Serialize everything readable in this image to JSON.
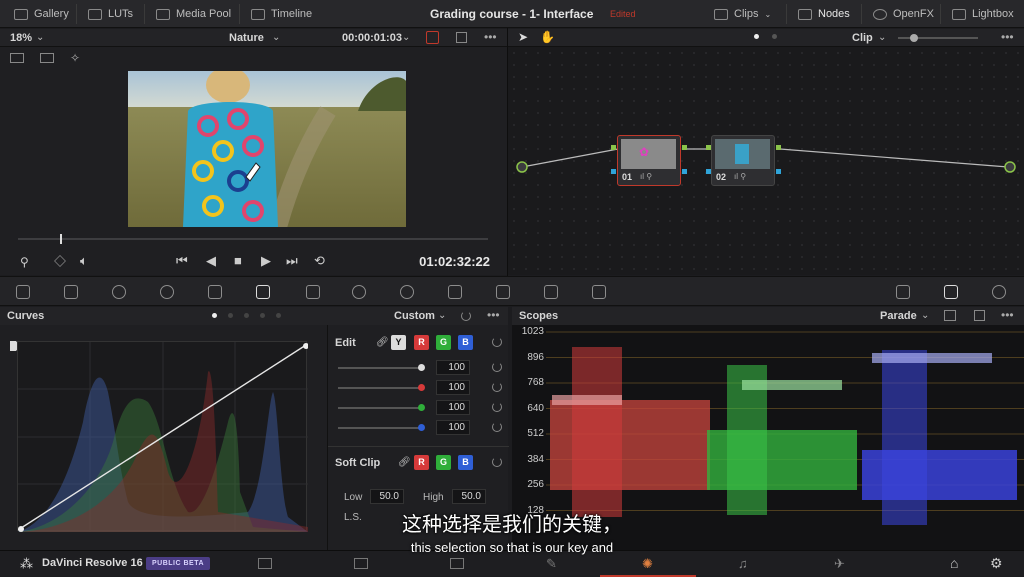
{
  "topbar": {
    "gallery": "Gallery",
    "luts": "LUTs",
    "media_pool": "Media Pool",
    "timeline": "Timeline",
    "project_title": "Grading course - 1- Interface",
    "edited": "Edited",
    "clips": "Clips",
    "nodes": "Nodes",
    "openfx": "OpenFX",
    "lightbox": "Lightbox"
  },
  "viewer": {
    "zoom": "18%",
    "clip_name": "Nature",
    "source_tc": "00:00:01:03",
    "record_tc": "01:02:32:22"
  },
  "node_editor": {
    "mode": "Clip",
    "node1_label": "01",
    "node2_label": "02"
  },
  "curves": {
    "title": "Curves",
    "preset": "Custom",
    "edit_label": "Edit",
    "channels": [
      "Y",
      "R",
      "G",
      "B"
    ],
    "values": [
      "100",
      "100",
      "100",
      "100"
    ],
    "soft_clip_label": "Soft Clip",
    "low_label": "Low",
    "low_value": "50.0",
    "high_label": "High",
    "high_value": "50.0",
    "ls_label": "L.S."
  },
  "scopes": {
    "title": "Scopes",
    "mode": "Parade",
    "ticks": [
      "1023",
      "896",
      "768",
      "640",
      "512",
      "384",
      "256",
      "128"
    ]
  },
  "footer": {
    "app_name": "DaVinci Resolve 16",
    "badge": "PUBLIC BETA"
  },
  "subtitle": {
    "zh": "这种选择是我们的关键，",
    "en": "this selection so that is our key and"
  },
  "colors": {
    "accent_red": "#c0392b",
    "channel_r": "#d63a3a",
    "channel_g": "#2fae3a",
    "channel_b": "#2f5fd6",
    "badge": "#4b3d86"
  }
}
